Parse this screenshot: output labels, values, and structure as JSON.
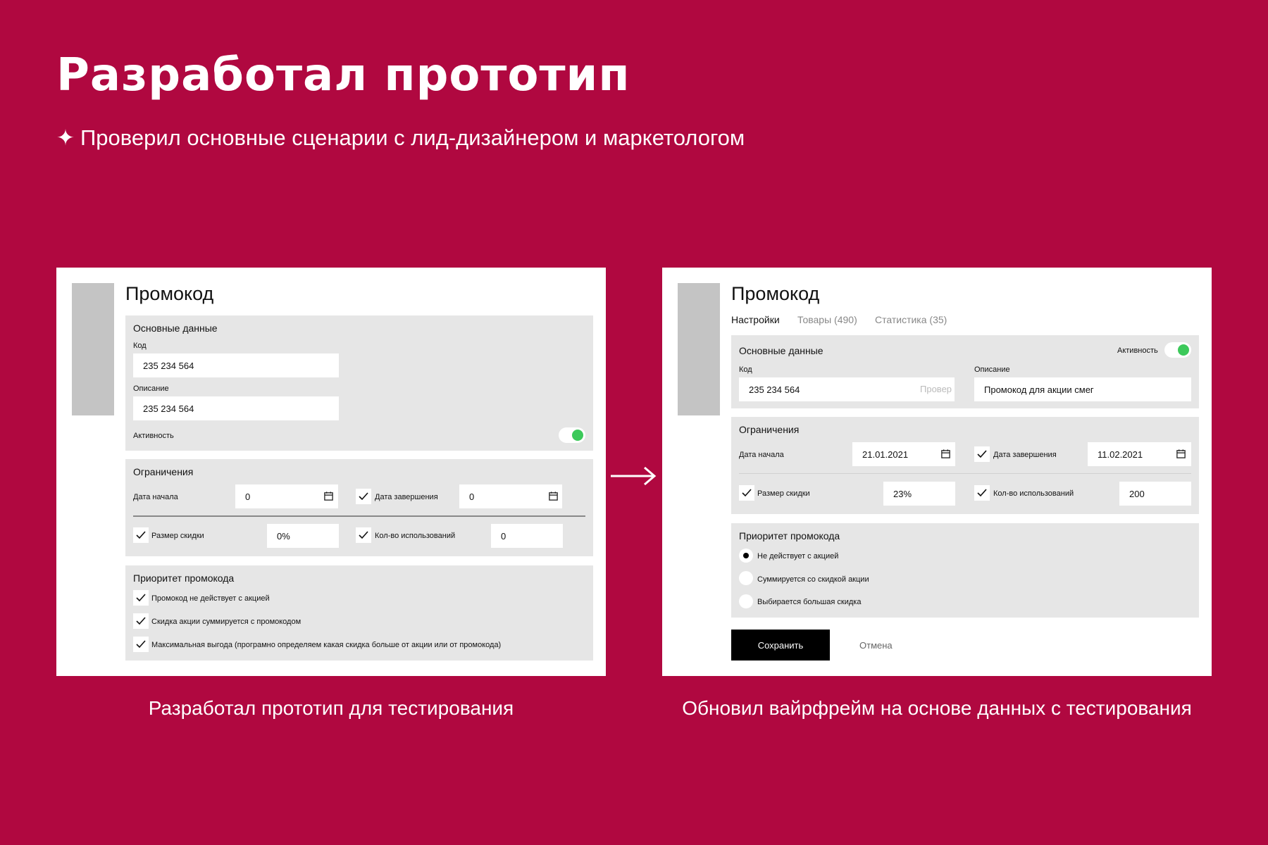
{
  "heading": {
    "title": "Разработал прототип",
    "subtitle_star": "✦",
    "subtitle": "Проверил основные сценарии с лид-дизайнером и маркетологом"
  },
  "captions": {
    "left": "Разработал прототип для тестирования",
    "right": "Обновил вайрфрейм на основе данных с тестирования"
  },
  "colors": {
    "background": "#b00840",
    "toggle_on": "#3cc95a",
    "section_bg": "#e6e6e6"
  },
  "left": {
    "title": "Промокод",
    "basic": {
      "heading": "Основные данные",
      "code_label": "Код",
      "code_value": "235 234 564",
      "desc_label": "Описание",
      "desc_value": "235 234 564",
      "active_label": "Активность",
      "active_on": true
    },
    "limits": {
      "heading": "Ограничения",
      "start_label": "Дата начала",
      "start_value": "0",
      "end_label": "Дата завершения",
      "end_value": "0",
      "discount_label": "Размер скидки",
      "discount_value": "0%",
      "uses_label": "Кол-во использований",
      "uses_value": "0"
    },
    "priority": {
      "heading": "Приоритет промокода",
      "options": [
        "Промокод не действует с акцией",
        "Скидка акции суммируется с промокодом",
        "Максимальная выгода (програмно определяем какая скидка больше от акции или от промокода)"
      ]
    }
  },
  "right": {
    "title": "Промокод",
    "tabs": [
      "Настройки",
      "Товары (490)",
      "Статистика (35)"
    ],
    "basic": {
      "heading": "Основные данные",
      "active_label": "Активность",
      "active_on": true,
      "code_label": "Код",
      "code_value": "235 234 564",
      "code_hint": "Провер",
      "desc_label": "Описание",
      "desc_value": "Промокод для акции смег"
    },
    "limits": {
      "heading": "Ограничения",
      "start_label": "Дата начала",
      "start_value": "21.01.2021",
      "end_label": "Дата завершения",
      "end_value": "11.02.2021",
      "discount_label": "Размер скидки",
      "discount_value": "23%",
      "uses_label": "Кол-во использований",
      "uses_value": "200"
    },
    "priority": {
      "heading": "Приоритет промокода",
      "options": [
        "Не действует с акцией",
        "Суммируется со скидкой акции",
        "Выбирается большая скидка"
      ],
      "selected": 0
    },
    "actions": {
      "save": "Сохранить",
      "cancel": "Отмена"
    }
  }
}
